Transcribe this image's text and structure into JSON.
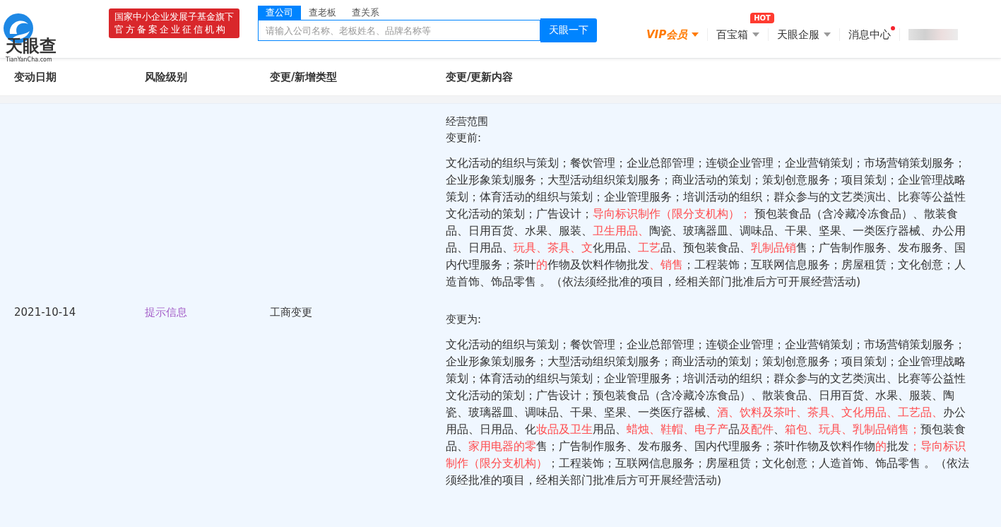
{
  "header": {
    "logo": {
      "name": "天眼查",
      "domain": "TianYanCha.com"
    },
    "badge": [
      "国家中小企业发展子基金旗下",
      "官方备案企业征信机构"
    ],
    "search": {
      "tabs": [
        {
          "label": "查公司",
          "selected": true
        },
        {
          "label": "查老板",
          "selected": false
        },
        {
          "label": "查关系",
          "selected": false
        }
      ],
      "placeholder": "请输入公司名称、老板姓名、品牌名称等",
      "button": "天眼一下"
    },
    "nav": [
      {
        "kind": "vip",
        "label": "VIP会员",
        "dropdown": true
      },
      {
        "kind": "plain",
        "label": "百宝箱",
        "dropdown": true,
        "tag": "HOT"
      },
      {
        "kind": "plain",
        "label": "天眼企服",
        "dropdown": true
      },
      {
        "kind": "plain",
        "label": "消息中心",
        "dropdown": false,
        "unread": true
      }
    ]
  },
  "table": {
    "columns": [
      "变动日期",
      "风险级别",
      "变更/新增类型",
      "变更/更新内容"
    ],
    "rows": [
      {
        "date": "2021-10-14",
        "risk": "提示信息",
        "type": "工商变更",
        "field": "经营范围",
        "before_label": "变更前:",
        "before": [
          {
            "text": "文化活动的组织与策划；餐饮管理；企业总部管理；连锁企业管理；企业营销策划；市场营销策划服务；企业形象策划服务；大型活动组织策划服务；商业活动的策划；策划创意服务；项目策划；企业管理战略策划；体育活动的组织与策划；企业管理服务；培训活动的组织；群众参与的文艺类演出、比赛等公益性文化活动的策划；广告设计；",
            "changed": false
          },
          {
            "text": "导向标识制作（限分支机构）；",
            "changed": true
          },
          {
            "text": " 预包装食品（含冷藏冷冻食品）、散装食品、日用百货、水果、服装、",
            "changed": false
          },
          {
            "text": "卫生用品、",
            "changed": true
          },
          {
            "text": "陶瓷、玻璃器皿、调味品、干果、坚果、一类医疗器械、办公用品、日用品、",
            "changed": false
          },
          {
            "text": "玩具、茶具、文",
            "changed": true
          },
          {
            "text": "化用品、",
            "changed": false
          },
          {
            "text": "工艺",
            "changed": true
          },
          {
            "text": "品、预包装食品、",
            "changed": false
          },
          {
            "text": "乳制品销",
            "changed": true
          },
          {
            "text": "售；广告制作服务、发布服务、国内代理服务；茶叶",
            "changed": false
          },
          {
            "text": "的",
            "changed": true
          },
          {
            "text": "作物及饮料作物批发",
            "changed": false
          },
          {
            "text": "、销售",
            "changed": true
          },
          {
            "text": "；工程装饰；互联网信息服务；房屋租赁；文化创意；人造首饰、饰品零售 。（依法须经批准的项目，经相关部门批准后方可开展经营活动)",
            "changed": false
          }
        ],
        "after_label": "变更为:",
        "after": [
          {
            "text": "文化活动的组织与策划；餐饮管理；企业总部管理；连锁企业管理；企业营销策划；市场营销策划服务；企业形象策划服务；大型活动组织策划服务；商业活动的策划；策划创意服务；项目策划；企业管理战略策划；体育活动的组织与策划；企业管理服务；培训活动的组织；群众参与的文艺类演出、比赛等公益性文化活动的策划；广告设计；预包装食品（含冷藏冷冻食品）、散装食品、日用百货、水果、服装、陶瓷、玻璃器皿、调味品、干果、坚果、一类医疗器械、",
            "changed": false
          },
          {
            "text": "酒、饮料及茶叶、茶具、文化用品、工艺品、",
            "changed": true
          },
          {
            "text": "办公用品、日用品、化",
            "changed": false
          },
          {
            "text": "妆品及卫生",
            "changed": true
          },
          {
            "text": "用品、",
            "changed": false
          },
          {
            "text": "蜡烛、鞋帽、电子产",
            "changed": true
          },
          {
            "text": "品",
            "changed": false
          },
          {
            "text": "及配件",
            "changed": true
          },
          {
            "text": "、",
            "changed": false
          },
          {
            "text": "箱包、玩具、乳制品销售；",
            "changed": true
          },
          {
            "text": "预包装食品、",
            "changed": false
          },
          {
            "text": "家用电器的零",
            "changed": true
          },
          {
            "text": "售；广告制作服务、发布服务、国内代理服务；茶叶作物及饮料作物",
            "changed": false
          },
          {
            "text": "的",
            "changed": true
          },
          {
            "text": "批发",
            "changed": false
          },
          {
            "text": "；导向标识制作（限分支机构）",
            "changed": true
          },
          {
            "text": "；工程装饰；互联网信息服务；房屋租赁；文化创意；人造首饰、饰品零售 。（依法须经批准的项目，经相关部门批准后方可开展经营活动)",
            "changed": false
          }
        ]
      }
    ]
  }
}
